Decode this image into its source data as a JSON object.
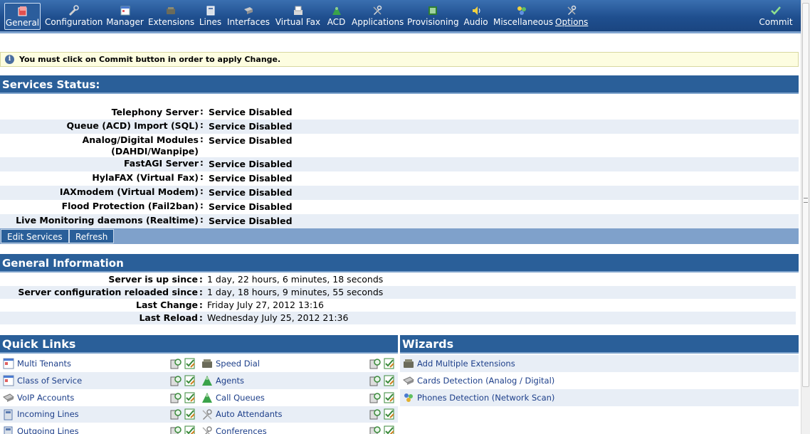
{
  "toolbar": {
    "items": [
      {
        "label": "General",
        "icon": "general-icon",
        "active": true
      },
      {
        "label": "Configuration",
        "icon": "configuration-icon"
      },
      {
        "label": "Manager",
        "icon": "manager-icon"
      },
      {
        "label": "Extensions",
        "icon": "extensions-icon"
      },
      {
        "label": "Lines",
        "icon": "lines-icon"
      },
      {
        "label": "Interfaces",
        "icon": "interfaces-icon"
      },
      {
        "label": "Virtual Fax",
        "icon": "fax-icon"
      },
      {
        "label": "ACD",
        "icon": "acd-icon"
      },
      {
        "label": "Applications",
        "icon": "applications-icon"
      },
      {
        "label": "Provisioning",
        "icon": "provisioning-icon"
      },
      {
        "label": "Audio",
        "icon": "audio-icon"
      },
      {
        "label": "Miscellaneous",
        "icon": "miscellaneous-icon"
      },
      {
        "label": "Options",
        "icon": "options-icon"
      }
    ],
    "commit": {
      "label": "Commit",
      "icon": "check-icon"
    }
  },
  "notice": "You must click on Commit button in order to apply Change.",
  "services": {
    "title": "Services Status:",
    "rows": [
      {
        "name": "Telephony Server",
        "status": "Service Disabled"
      },
      {
        "name": "Queue (ACD) Import (SQL)",
        "status": "Service Disabled"
      },
      {
        "name": "Analog/Digital Modules",
        "name2": "(DAHDI/Wanpipe)",
        "status": "Service Disabled"
      },
      {
        "name": "FastAGI Server",
        "status": "Service Disabled"
      },
      {
        "name": "HylaFAX (Virtual Fax)",
        "status": "Service Disabled"
      },
      {
        "name": "IAXmodem (Virtual Modem)",
        "status": "Service Disabled"
      },
      {
        "name": "Flood Protection (Fail2ban)",
        "status": "Service Disabled"
      },
      {
        "name": "Live Monitoring daemons (Realtime)",
        "status": "Service Disabled"
      }
    ],
    "edit_button": "Edit Services",
    "refresh_button": "Refresh"
  },
  "general_info": {
    "title": "General Information",
    "rows": [
      {
        "name": "Server is up since",
        "value": "1 day, 22 hours, 6 minutes, 18 seconds"
      },
      {
        "name": "Server configuration reloaded since",
        "value": "1 day, 18 hours, 9 minutes, 55 seconds"
      },
      {
        "name": "Last Change",
        "value": "Friday July 27, 2012 13:16"
      },
      {
        "name": "Last Reload",
        "value": "Wednesday July 25, 2012 21:36"
      }
    ]
  },
  "quick_links": {
    "title": "Quick Links",
    "left": [
      {
        "label": "Multi Tenants",
        "icon": "tenants-icon"
      },
      {
        "label": "Class of Service",
        "icon": "class-of-service-icon"
      },
      {
        "label": "VoIP Accounts",
        "icon": "voip-icon"
      },
      {
        "label": "Incoming Lines",
        "icon": "incoming-lines-icon"
      },
      {
        "label": "Outgoing Lines",
        "icon": "outgoing-lines-icon"
      }
    ],
    "right": [
      {
        "label": "Speed Dial",
        "icon": "speed-dial-icon"
      },
      {
        "label": "Agents",
        "icon": "agents-icon"
      },
      {
        "label": "Call Queues",
        "icon": "call-queues-icon"
      },
      {
        "label": "Auto Attendants",
        "icon": "auto-attendants-icon"
      },
      {
        "label": "Conferences",
        "icon": "conferences-icon"
      }
    ]
  },
  "wizards": {
    "title": "Wizards",
    "items": [
      {
        "label": "Add Multiple Extensions",
        "icon": "add-extensions-icon"
      },
      {
        "label": "Cards Detection (Analog / Digital)",
        "icon": "cards-detection-icon"
      },
      {
        "label": "Phones Detection (Network Scan)",
        "icon": "phones-detection-icon"
      }
    ]
  },
  "colors": {
    "header_blue": "#2a5f99",
    "row_alt": "#e8eef6",
    "link": "#1d3f8a",
    "notice_bg": "#fdfde0"
  }
}
